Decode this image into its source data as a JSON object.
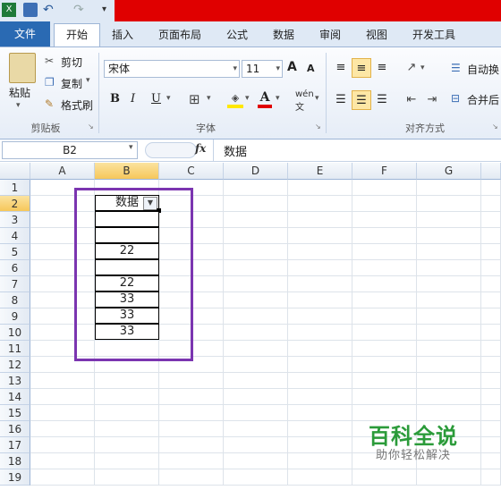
{
  "tabs": [
    "文件",
    "开始",
    "插入",
    "页面布局",
    "公式",
    "数据",
    "审阅",
    "视图",
    "开发工具"
  ],
  "clipboard": {
    "paste": "粘贴",
    "cut": "剪切",
    "copy": "复制",
    "format_painter": "格式刷",
    "group": "剪贴板"
  },
  "font": {
    "name": "宋体",
    "size": "11",
    "group": "字体",
    "bold": "B",
    "italic": "I",
    "underline": "U",
    "grow": "A",
    "shrink": "A"
  },
  "alignment": {
    "wrap": "自动换",
    "merge": "合并后",
    "group": "对齐方式"
  },
  "formula_bar": {
    "name_box": "B2",
    "fx": "fx",
    "content": "数据"
  },
  "columns": [
    "A",
    "B",
    "C",
    "D",
    "E",
    "F",
    "G"
  ],
  "rows": [
    "1",
    "2",
    "3",
    "4",
    "5",
    "6",
    "7",
    "8",
    "9",
    "10",
    "11",
    "12",
    "13",
    "14",
    "15",
    "16",
    "17",
    "18",
    "19"
  ],
  "b_cells": [
    "数据",
    "",
    "",
    "22",
    "",
    "22",
    "33",
    "33",
    "33"
  ],
  "watermark": {
    "title": "百科全说",
    "subtitle": "助你轻松解决"
  },
  "colors": {
    "selection": "#7b35b0",
    "watermark": "#2b9b3a",
    "title_bar": "#e00000"
  }
}
